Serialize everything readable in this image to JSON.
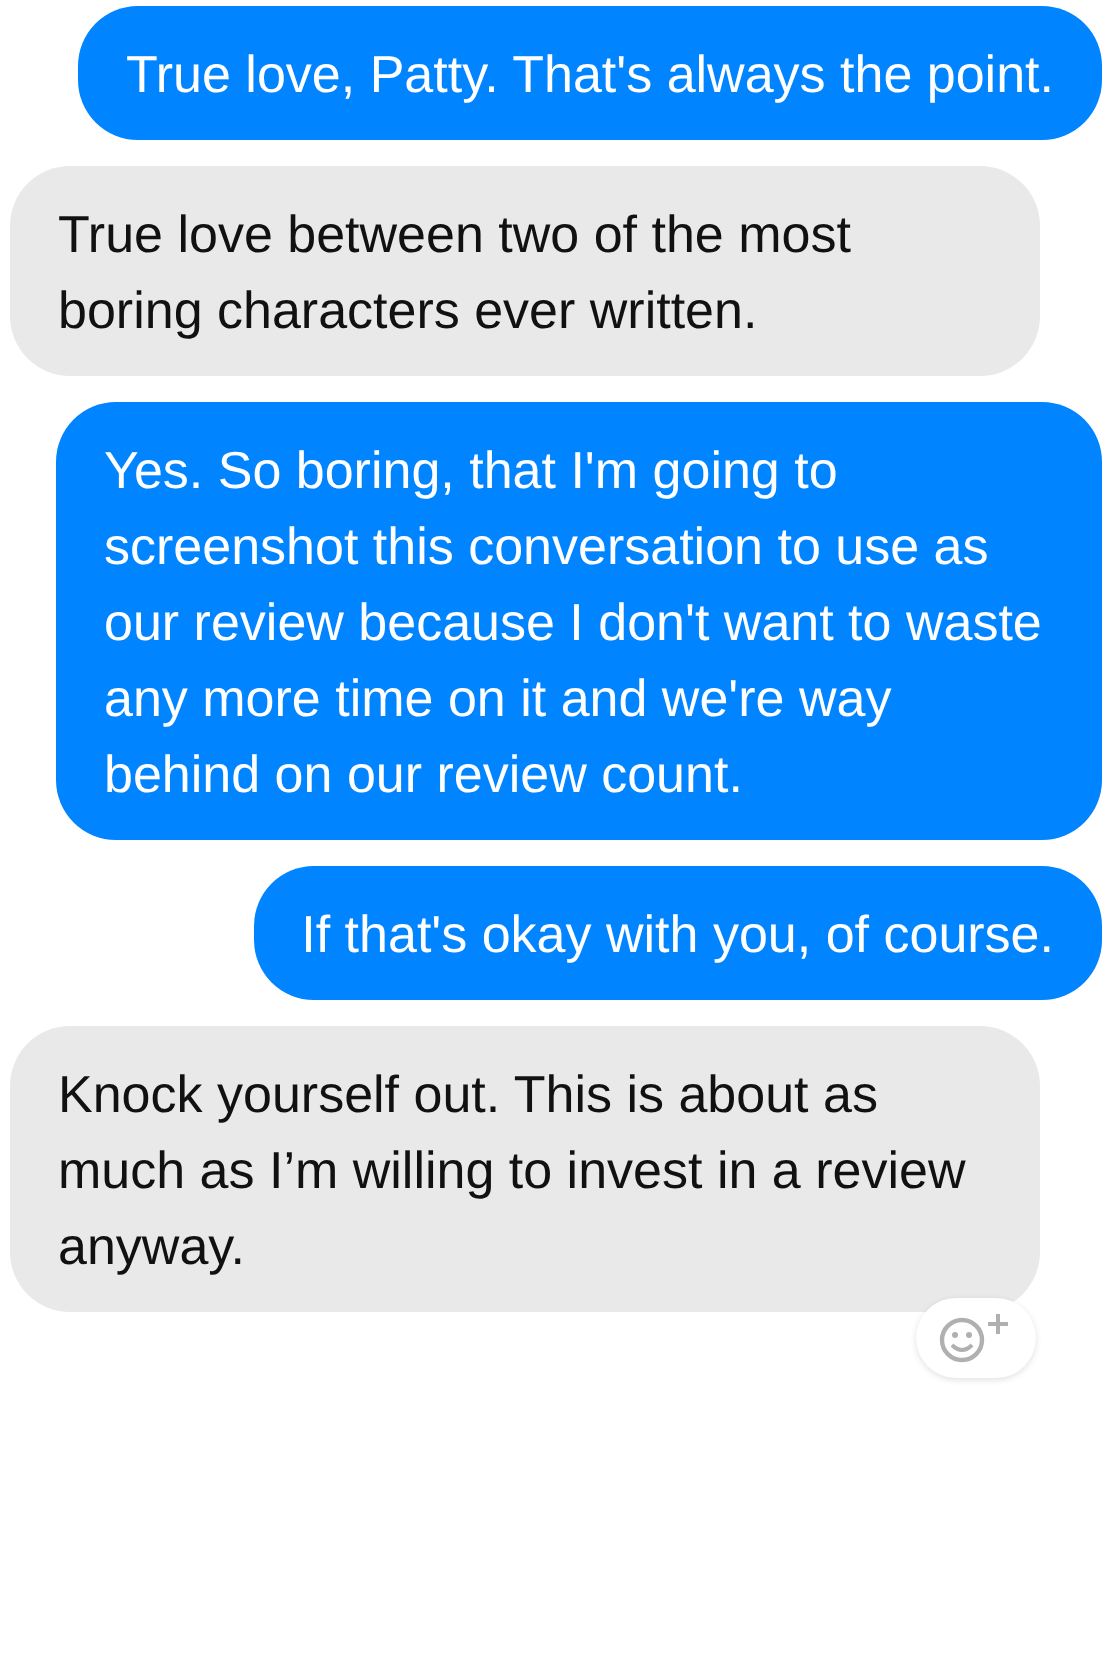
{
  "messages": [
    {
      "kind": "sent",
      "text": "True love, Patty. That's always the point."
    },
    {
      "kind": "received",
      "text": "True love between two of the most boring characters ever written."
    },
    {
      "kind": "sent",
      "text": "Yes. So boring, that I'm going to screenshot this conversation to use as our review because I don't want to waste any more time on it and we're way behind on our review count."
    },
    {
      "kind": "sent",
      "text": "If that's okay with you, of course."
    },
    {
      "kind": "received",
      "text": "Knock yourself out. This is about as much as I’m willing to invest in a review anyway."
    }
  ]
}
